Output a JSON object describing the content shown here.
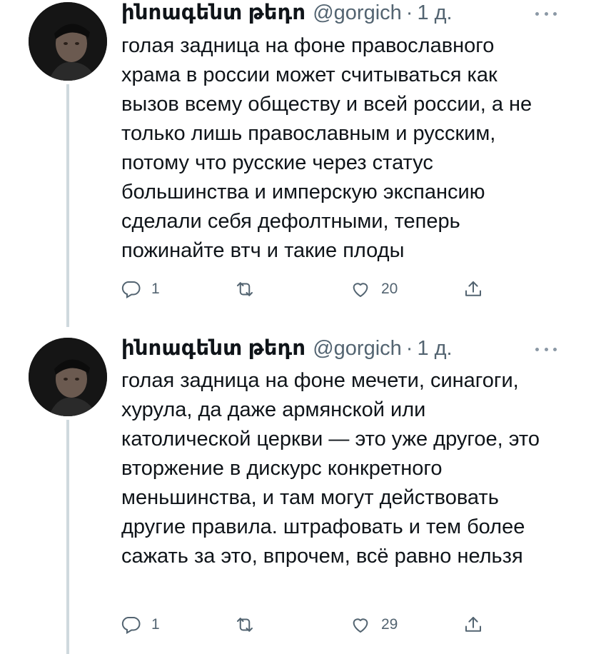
{
  "tweets": [
    {
      "author": {
        "name": "ինոագենտ թեդո",
        "handle": "@gorgich"
      },
      "separator": "·",
      "time": "1 д.",
      "text": "голая задница на фоне православного храма в россии может считываться как вызов всему обществу и всей россии, а не только лишь православным и русским, потому что русские через статус большинства и имперскую экспансию сделали себя дефолтными, теперь пожинайте втч и такие плоды",
      "replies": "1",
      "retweets": "",
      "likes": "20",
      "icons": {
        "reply": "reply-icon",
        "retweet": "retweet-icon",
        "like": "heart-icon",
        "share": "share-icon",
        "more": "more-icon"
      }
    },
    {
      "author": {
        "name": "ինոագենտ թեդո",
        "handle": "@gorgich"
      },
      "separator": "·",
      "time": "1 д.",
      "text": "голая задница на фоне мечети, синагоги, хурула, да даже армянской или католической церкви — это уже другое, это вторжение в дискурс конкретного меньшинства, и там могут действовать другие правила. штрафовать и тем более сажать за это, впрочем, всё равно нельзя",
      "replies": "1",
      "retweets": "",
      "likes": "29",
      "icons": {
        "reply": "reply-icon",
        "retweet": "retweet-icon",
        "like": "heart-icon",
        "share": "share-icon",
        "more": "more-icon"
      }
    }
  ],
  "colors": {
    "text": "#0f1419",
    "secondary": "#536471",
    "thread_line": "#cfd9de",
    "background": "#ffffff"
  }
}
